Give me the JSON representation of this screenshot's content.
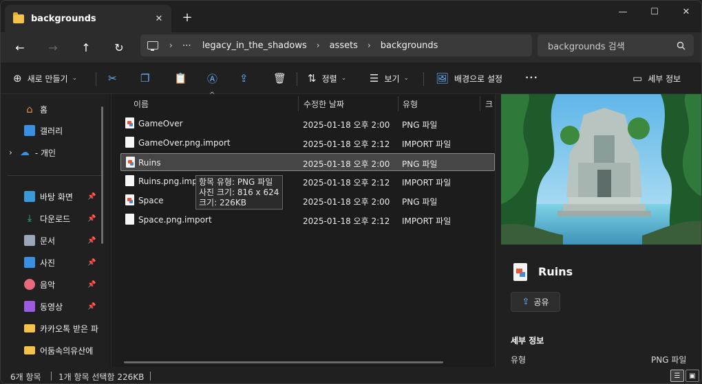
{
  "window": {
    "tab_title": "backgrounds",
    "icons": {
      "tab": "folder-icon",
      "close_tab": "close-icon",
      "new_tab": "plus-icon",
      "minimize": "minimize-icon",
      "maximize": "maximize-icon",
      "close_window": "close-icon"
    }
  },
  "addressbar": {
    "ellipsis": "⋯",
    "breadcrumbs": [
      "legacy_in_the_shadows",
      "assets",
      "backgrounds"
    ],
    "search_placeholder": "backgrounds 검색"
  },
  "commandbar": {
    "new_label": "새로 만들기",
    "sort_label": "정렬",
    "view_label": "보기",
    "set_background_label": "배경으로 설정",
    "more_label": "•••",
    "details_label": "세부 정보"
  },
  "navpane": {
    "items": [
      {
        "label": "홈",
        "icon": "home-icon",
        "color": "#e0894a"
      },
      {
        "label": "갤러리",
        "icon": "gallery-icon",
        "color": "#3a8fe0"
      },
      {
        "label": "- 개인",
        "icon": "onedrive-icon",
        "color": "#3a8fe0"
      },
      {
        "label": "바탕 화면",
        "icon": "desktop-icon",
        "color": "#3a9ad9",
        "pinned": true
      },
      {
        "label": "다운로드",
        "icon": "download-icon",
        "color": "#3ec27a",
        "pinned": true
      },
      {
        "label": "문서",
        "icon": "document-icon",
        "color": "#9aa7b8",
        "pinned": true
      },
      {
        "label": "사진",
        "icon": "pictures-icon",
        "color": "#3a8fe0",
        "pinned": true
      },
      {
        "label": "음악",
        "icon": "music-icon",
        "color": "#e86a7a",
        "pinned": true
      },
      {
        "label": "동영상",
        "icon": "videos-icon",
        "color": "#9b5ce0",
        "pinned": true
      },
      {
        "label": "카카오톡 받은 파",
        "icon": "folder-icon",
        "color": "#f4c24b"
      },
      {
        "label": "어둠속의유산에",
        "icon": "folder-icon",
        "color": "#f4c24b"
      }
    ]
  },
  "filelist": {
    "columns": {
      "name": "이름",
      "modified": "수정한 날짜",
      "type": "유형",
      "size": "크"
    },
    "rows": [
      {
        "name": "GameOver",
        "modified": "2025-01-18 오후 2:00",
        "type": "PNG 파일",
        "kind": "png"
      },
      {
        "name": "GameOver.png.import",
        "modified": "2025-01-18 오후 2:12",
        "type": "IMPORT 파일",
        "kind": "file"
      },
      {
        "name": "Ruins",
        "modified": "2025-01-18 오후 2:00",
        "type": "PNG 파일",
        "kind": "png",
        "selected": true
      },
      {
        "name": "Ruins.png.impo",
        "modified": "2025-01-18 오후 2:12",
        "type": "IMPORT 파일",
        "kind": "file"
      },
      {
        "name": "Space",
        "modified": "2025-01-18 오후 2:00",
        "type": "PNG 파일",
        "kind": "png"
      },
      {
        "name": "Space.png.import",
        "modified": "2025-01-18 오후 2:12",
        "type": "IMPORT 파일",
        "kind": "file"
      }
    ]
  },
  "tooltip": {
    "lines": [
      "항목 유형: PNG 파일",
      "사진 크기: 816 x 624",
      "크기: 226KB"
    ]
  },
  "preview": {
    "name": "Ruins",
    "share_label": "공유",
    "details_heading": "세부 정보",
    "type_key": "유형",
    "type_value": "PNG 파일"
  },
  "statusbar": {
    "count": "6개 항목",
    "selection": "1개 항목 선택함 226KB"
  },
  "colors": {
    "accent": "#67b3ff",
    "folder": "#f4c24b",
    "selected_row": "#464646"
  }
}
